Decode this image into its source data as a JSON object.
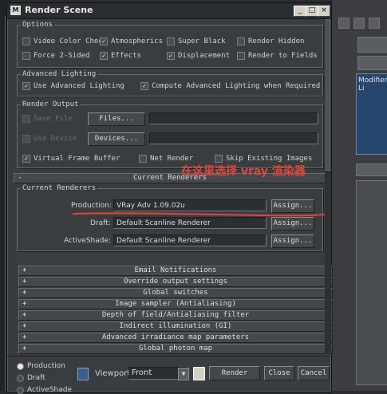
{
  "window": {
    "title": "Render Scene",
    "icon": "3ds-max-icon",
    "controls": [
      "_",
      "□",
      "×"
    ]
  },
  "options": {
    "label": "Options",
    "row1": [
      {
        "label": "Video Color Check",
        "checked": false
      },
      {
        "label": "Atmospherics",
        "checked": true
      },
      {
        "label": "Super Black",
        "checked": false
      },
      {
        "label": "Render Hidden",
        "checked": false
      }
    ],
    "row2": [
      {
        "label": "Force 2-Sided",
        "checked": false
      },
      {
        "label": "Effects",
        "checked": true
      },
      {
        "label": "Displacement",
        "checked": true
      },
      {
        "label": "Render to Fields",
        "checked": false
      }
    ]
  },
  "advanced_lighting": {
    "label": "Advanced Lighting",
    "use": {
      "label": "Use Advanced Lighting",
      "checked": true
    },
    "compute": {
      "label": "Compute Advanced Lighting when Required",
      "checked": true
    }
  },
  "render_output": {
    "label": "Render Output",
    "save_file": {
      "label": "Save File",
      "checked": false
    },
    "files_button": "Files...",
    "use_device": {
      "label": "Use Device",
      "checked": false
    },
    "devices_button": "Devices...",
    "vfb": {
      "label": "Virtual Frame Buffer",
      "checked": true
    },
    "net_render": {
      "label": "Net Render",
      "checked": false
    },
    "skip_existing": {
      "label": "Skip Existing Images",
      "checked": false
    }
  },
  "current_renderers_rollout": {
    "title": "Current Renderers",
    "sign": "-"
  },
  "current_renderers": {
    "label": "Current Renderers",
    "production": {
      "label": "Production:",
      "value": "VRay Adv 1.09.02u",
      "button": "Assign..."
    },
    "draft": {
      "label": "Draft:",
      "value": "Default Scanline Renderer",
      "button": "Assign..."
    },
    "activeshade": {
      "label": "ActiveShade:",
      "value": "Default Scanline Renderer",
      "button": "Assign..."
    }
  },
  "annotation": "在这里选择 vray 渲染器",
  "rollouts": [
    {
      "sign": "+",
      "title": "Email Notifications"
    },
    {
      "sign": "+",
      "title": "Override output settings"
    },
    {
      "sign": "+",
      "title": "Global switches"
    },
    {
      "sign": "+",
      "title": "Image sampler (Antialiasing)"
    },
    {
      "sign": "+",
      "title": "Depth of field/Antialiasing filter"
    },
    {
      "sign": "+",
      "title": "Indirect illumination (GI)"
    },
    {
      "sign": "+",
      "title": "Advanced irradiance map parameters"
    },
    {
      "sign": "+",
      "title": "Global photon map"
    }
  ],
  "bottom": {
    "production_radio": "Production",
    "draft_radio": "Draft",
    "activeshade_radio": "ActiveShade",
    "viewport_label": "Viewport:",
    "viewport_value": "Front",
    "render_button": "Render",
    "close_button": "Close",
    "cancel_button": "Cancel"
  },
  "background": {
    "modifier_label": "Modifier Li"
  },
  "colors": {
    "annotation": "#e0463c",
    "dialog": "#3a3d40"
  }
}
